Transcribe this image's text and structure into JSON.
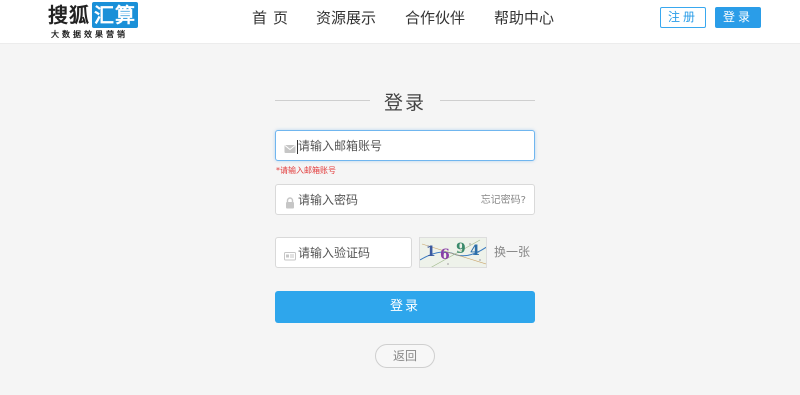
{
  "brand": {
    "name": "搜狐",
    "mark": "汇算",
    "tagline": "大数据效果营销"
  },
  "nav": {
    "home": "首页",
    "resources": "资源展示",
    "partners": "合作伙伴",
    "help": "帮助中心"
  },
  "header_actions": {
    "register": "注册",
    "login": "登录"
  },
  "login_form": {
    "title": "登录",
    "email": {
      "placeholder": "请输入邮箱账号",
      "error": "*请输入邮箱账号"
    },
    "password": {
      "placeholder": "请输入密码",
      "forgot": "忘记密码?"
    },
    "captcha": {
      "placeholder": "请输入验证码",
      "code": [
        "1",
        "6",
        "9",
        "4"
      ],
      "refresh": "换一张"
    },
    "submit": "登录",
    "back": "返回"
  },
  "colors": {
    "accent": "#2ea6ec",
    "error": "#e23b3b",
    "background": "#f5f5f5"
  },
  "icons": {
    "email": "mail-icon",
    "password": "lock-icon",
    "captcha": "id-card-icon"
  }
}
